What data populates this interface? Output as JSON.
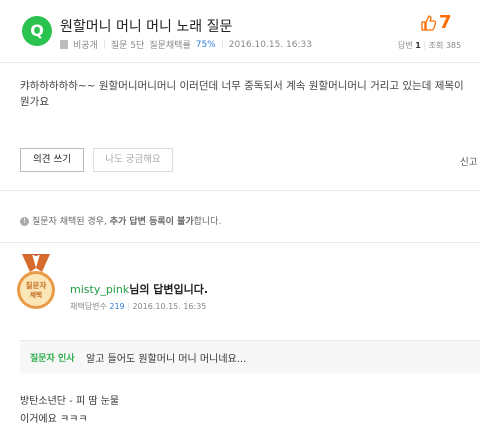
{
  "question": {
    "icon_letter": "Q",
    "title": "원할머니 머니 머니 노래 질문",
    "author": "비공개",
    "level": "질문 5단",
    "rate_label": "질문채택률",
    "rate_value": "75%",
    "date": "2016.10.15. 16:33",
    "likes": "7",
    "answers_label": "답변",
    "answers_count": "1",
    "views_label": "조회",
    "views_count": "385",
    "body": "캬하하하하하~~ 원할머니머니머니 이러던데 너무 중독되서 계속 원할머니머니 거리고 있는데 제목이 뭔가요"
  },
  "actions": {
    "comment_button": "의견 쓰기",
    "curious_button": "나도 궁금해요",
    "report_link": "신고"
  },
  "notice": {
    "text_prefix": "질문자 채택된 경우, ",
    "text_bold": "추가 답변 등록이 불가",
    "text_suffix": "합니다."
  },
  "answer": {
    "medal_line1": "질문자",
    "medal_line2": "채택",
    "nickname": "misty_pink",
    "suffix": "님의 답변입니다.",
    "meta_label": "채택답변수",
    "meta_count": "219",
    "date": "2016.10.15. 16:35",
    "asker_label": "질문자 인사",
    "asker_text": "알고 들어도 원할머니 머니 머니네요...",
    "line1": "방탄소년단 - 피 땀 눈물",
    "line2": "이거에요 ㅋㅋㅋ"
  },
  "colors": {
    "accent_green": "#2bc34f",
    "like_orange": "#ff6b00",
    "link_blue": "#2f7fd8",
    "medal_bronze": "#d98c3a"
  }
}
